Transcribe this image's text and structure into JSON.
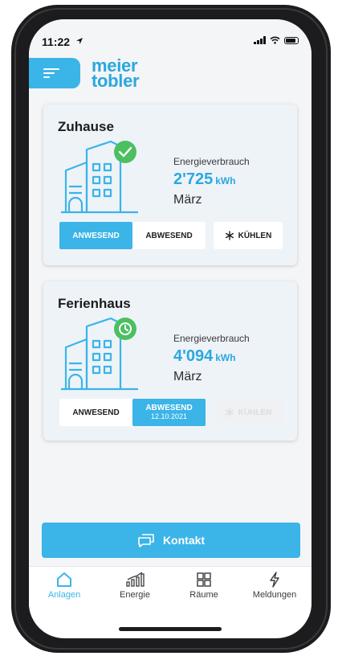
{
  "status_bar": {
    "time": "11:22"
  },
  "header": {
    "logo_line1": "meier",
    "logo_line2": "tobler"
  },
  "cards": [
    {
      "title": "Zuhause",
      "badge": "check-icon",
      "energy_label": "Energieverbrauch",
      "energy_value": "2'725",
      "energy_unit": "kWh",
      "month": "März",
      "present_label": "ANWESEND",
      "absent_label": "ABWESEND",
      "absent_date": "",
      "active": "present",
      "cool_label": "KÜHLEN",
      "cool_enabled": true
    },
    {
      "title": "Ferienhaus",
      "badge": "clock-icon",
      "energy_label": "Energieverbrauch",
      "energy_value": "4'094",
      "energy_unit": "kWh",
      "month": "März",
      "present_label": "ANWESEND",
      "absent_label": "ABWESEND",
      "absent_date": "12.10.2021",
      "active": "absent",
      "cool_label": "KÜHLEN",
      "cool_enabled": false
    }
  ],
  "contact_button": {
    "label": "Kontakt"
  },
  "tabs": [
    {
      "label": "Anlagen",
      "icon": "home-icon",
      "active": true
    },
    {
      "label": "Energie",
      "icon": "energy-chart-icon",
      "active": false
    },
    {
      "label": "Räume",
      "icon": "rooms-grid-icon",
      "active": false
    },
    {
      "label": "Meldungen",
      "icon": "lightning-icon",
      "active": false
    }
  ],
  "colors": {
    "accent": "#3bb4e8",
    "badge_green": "#4cbf5f",
    "background": "#f4f5f7"
  }
}
